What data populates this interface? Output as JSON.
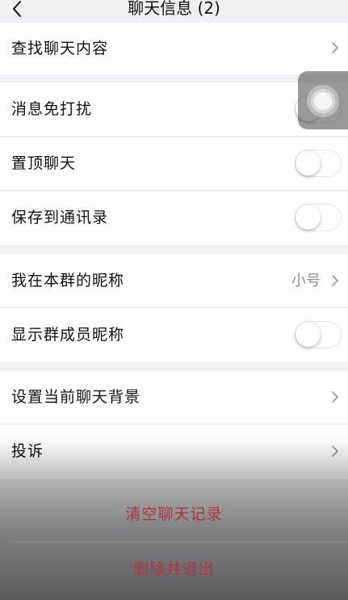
{
  "nav": {
    "title": "聊天信息 (2)",
    "back_icon": "chevron-left-icon"
  },
  "rows": {
    "search_history": {
      "label": "查找聊天内容"
    },
    "mute": {
      "label": "消息免打扰",
      "on": false
    },
    "pin": {
      "label": "置顶聊天",
      "on": false
    },
    "save_contacts": {
      "label": "保存到通讯录",
      "on": false
    },
    "nickname": {
      "label": "我在本群的昵称",
      "value": "小号"
    },
    "show_nicknames": {
      "label": "显示群成员昵称",
      "on": false
    },
    "background": {
      "label": "设置当前聊天背景"
    },
    "report": {
      "label": "投诉"
    }
  },
  "actions": {
    "clear": {
      "label": "清空聊天记录"
    },
    "delete_exit": {
      "label": "删除并退出"
    }
  },
  "colors": {
    "destructive": "#b2343f",
    "toggle_off": "#ffffff"
  }
}
